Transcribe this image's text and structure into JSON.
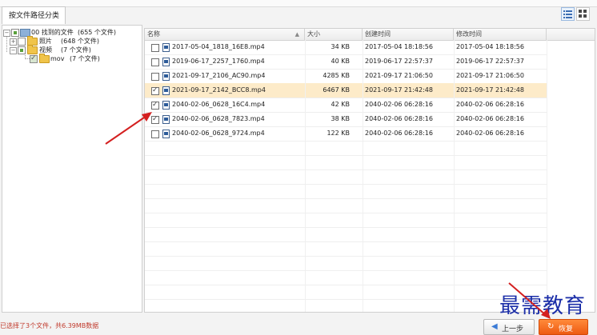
{
  "tabs": [
    {
      "label": "按文件路径分类"
    }
  ],
  "tree": {
    "root": {
      "label": "00 找到的文件",
      "count": "(655 个文件)"
    },
    "items": [
      {
        "label": "照片",
        "count": "(648 个文件)"
      },
      {
        "label": "视频",
        "count": "(7 个文件)"
      },
      {
        "label": "mov",
        "count": "(7 个文件)"
      }
    ]
  },
  "list": {
    "columns": [
      "名称",
      "大小",
      "创建时间",
      "修改时间"
    ],
    "rows": [
      {
        "name": "2017-05-04_1818_16E8.mp4",
        "size": "34 KB",
        "created": "2017-05-04  18:18:56",
        "modified": "2017-05-04  18:18:56",
        "checked": false,
        "selected": false
      },
      {
        "name": "2019-06-17_2257_1760.mp4",
        "size": "40 KB",
        "created": "2019-06-17  22:57:37",
        "modified": "2019-06-17  22:57:37",
        "checked": false,
        "selected": false
      },
      {
        "name": "2021-09-17_2106_AC90.mp4",
        "size": "4285 KB",
        "created": "2021-09-17  21:06:50",
        "modified": "2021-09-17  21:06:50",
        "checked": false,
        "selected": false
      },
      {
        "name": "2021-09-17_2142_BCC8.mp4",
        "size": "6467 KB",
        "created": "2021-09-17  21:42:48",
        "modified": "2021-09-17  21:42:48",
        "checked": true,
        "selected": true
      },
      {
        "name": "2040-02-06_0628_16C4.mp4",
        "size": "42 KB",
        "created": "2040-02-06  06:28:16",
        "modified": "2040-02-06  06:28:16",
        "checked": true,
        "selected": false
      },
      {
        "name": "2040-02-06_0628_7823.mp4",
        "size": "38 KB",
        "created": "2040-02-06  06:28:16",
        "modified": "2040-02-06  06:28:16",
        "checked": true,
        "selected": false
      },
      {
        "name": "2040-02-06_0628_9724.mp4",
        "size": "122 KB",
        "created": "2040-02-06  06:28:16",
        "modified": "2040-02-06  06:28:16",
        "checked": false,
        "selected": false
      }
    ]
  },
  "status_text": "已选择了3个文件，共6.39MB数据",
  "buttons": {
    "prev": "上一步",
    "recover": "恢复"
  },
  "watermark": "最需教育",
  "colors": {
    "accent": "#ee5a12",
    "arrow": "#d42020",
    "selection": "#fdebc9",
    "watermark": "#1b2ea8"
  },
  "icons": [
    "list-view-icon",
    "grid-view-icon",
    "folder-icon",
    "drive-icon",
    "video-file-icon",
    "back-arrow-icon",
    "recover-icon"
  ]
}
